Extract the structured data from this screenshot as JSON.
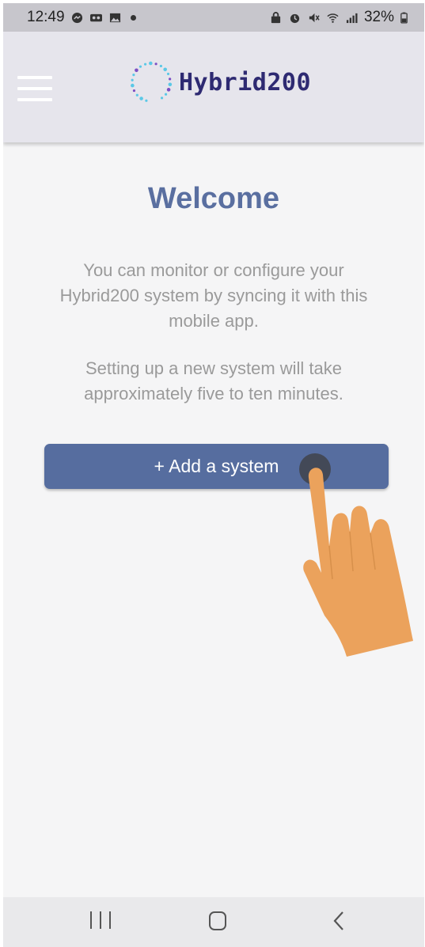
{
  "status_bar": {
    "time": "12:49",
    "battery": "32%",
    "icons": [
      "messenger-icon",
      "voicemail-icon",
      "gallery-icon",
      "dot-icon",
      "lock-icon",
      "alarm-icon",
      "mute-icon",
      "wifi-icon",
      "signal-icon",
      "battery-icon"
    ]
  },
  "header": {
    "logo_text": "Hybrid200",
    "logo_colors": {
      "text": "#2e2a72",
      "dots_primary": "#5bc8e6",
      "dots_secondary": "#7b4fc4"
    },
    "background": "#e6e5ec"
  },
  "main": {
    "title": "Welcome",
    "intro": "You can monitor or configure your Hybrid200 system by syncing it with this mobile app.",
    "setup_note": "Setting up a new system will take approximately five to ten minutes.",
    "add_button_label": "+ Add a system",
    "accent_color": "#566d9f"
  },
  "overlay": {
    "hand_pointer_icon": "hand-pointer-icon",
    "hand_color": "#eba25c"
  },
  "nav_bar": {
    "buttons": [
      "recent-apps-icon",
      "home-icon",
      "back-icon"
    ]
  }
}
